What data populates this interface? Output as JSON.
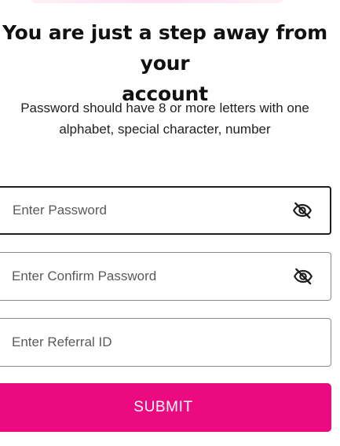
{
  "heading": {
    "line1": "You are just a step away from your",
    "line2": "account"
  },
  "helper": {
    "line1": "Password should have 8 or more letters with one",
    "line2": "alphabet, special character, number"
  },
  "form": {
    "password": {
      "placeholder": "Enter Password",
      "value": "",
      "toggle_icon": "eye-slash-icon"
    },
    "confirm_password": {
      "placeholder": "Enter Confirm Password",
      "value": "",
      "toggle_icon": "eye-slash-icon"
    },
    "referral": {
      "placeholder": "Enter Referral ID",
      "value": ""
    },
    "submit_label": "SUBMIT"
  },
  "colors": {
    "accent": "#ec0a80",
    "text": "#111111",
    "border": "#8a8a8a"
  }
}
